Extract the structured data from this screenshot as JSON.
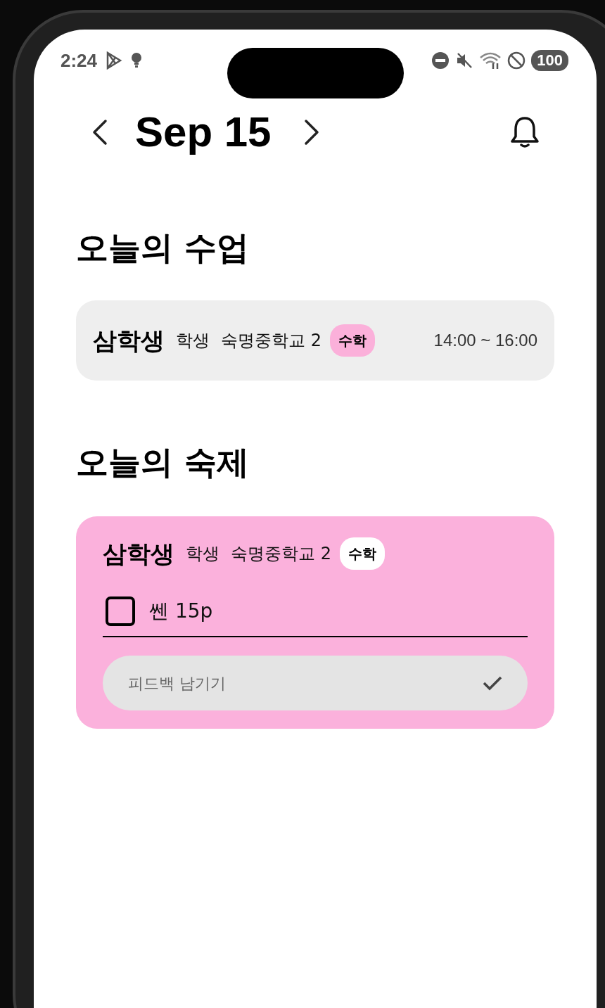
{
  "status_bar": {
    "time": "2:24",
    "battery": "100"
  },
  "header": {
    "date": "Sep 15"
  },
  "classes": {
    "title": "오늘의 수업",
    "items": [
      {
        "name": "삼학생",
        "role": "학생",
        "school": "숙명중학교 2",
        "subject": "수학",
        "time": "14:00 ~ 16:00"
      }
    ]
  },
  "homework": {
    "title": "오늘의 숙제",
    "items": [
      {
        "name": "삼학생",
        "role": "학생",
        "school": "숙명중학교 2",
        "subject": "수학",
        "tasks": [
          {
            "label": "쎈 15p",
            "checked": false
          }
        ],
        "feedback": {
          "placeholder": "피드백 남기기"
        }
      }
    ]
  }
}
